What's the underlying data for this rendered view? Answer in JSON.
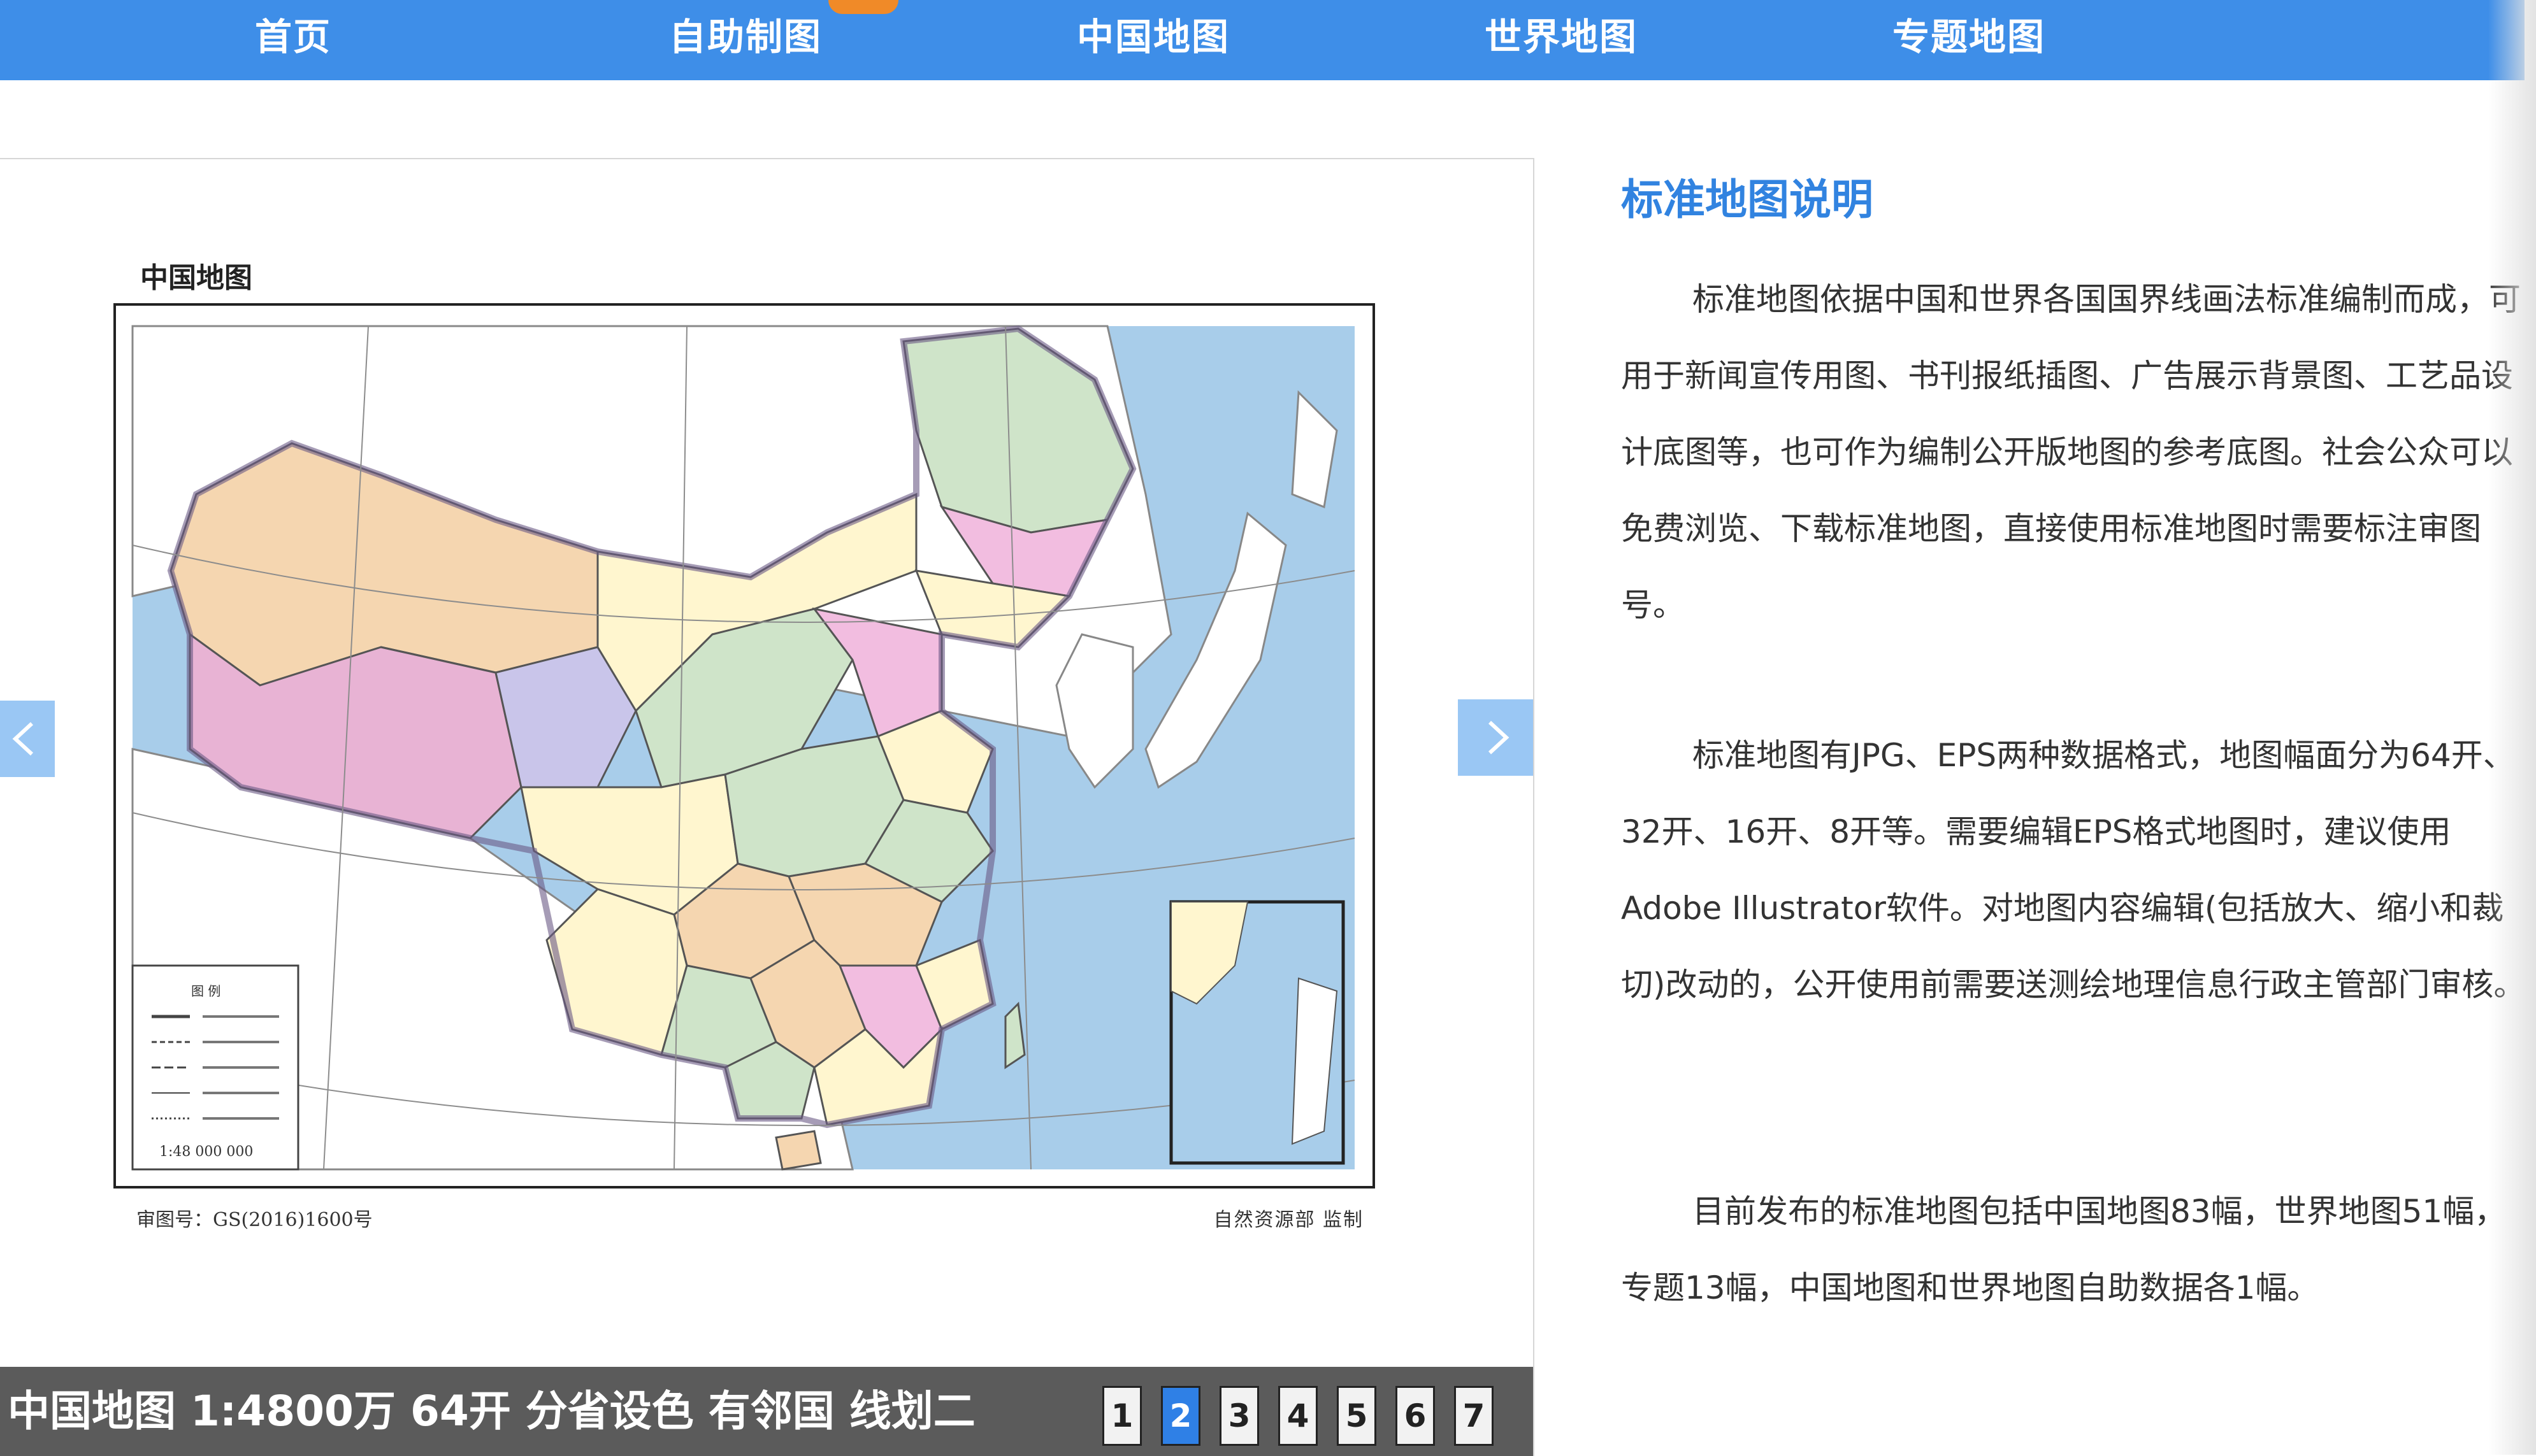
{
  "nav": {
    "items": [
      {
        "label": "首页"
      },
      {
        "label": "自助制图"
      },
      {
        "label": "中国地图"
      },
      {
        "label": "世界地图"
      },
      {
        "label": "专题地图"
      }
    ]
  },
  "slider": {
    "map_title": "中国地图",
    "legend_title": "图 例",
    "legend_scale": "1:48 000 000",
    "approval_number": "审图号：GS(2016)1600号",
    "publisher": "自然资源部  监制",
    "caption": "中国地图 1:4800万 64开 分省设色 有邻国 线划二",
    "pages": [
      "1",
      "2",
      "3",
      "4",
      "5",
      "6",
      "7"
    ],
    "active_page": "2",
    "prev_icon": "chevron-left-icon",
    "next_icon": "chevron-right-icon"
  },
  "info": {
    "title": "标准地图说明",
    "paragraphs": [
      "标准地图依据中国和世界各国国界线画法标准编制而成，可用于新闻宣传用图、书刊报纸插图、广告展示背景图、工艺品设计底图等，也可作为编制公开版地图的参考底图。社会公众可以免费浏览、下载标准地图，直接使用标准地图时需要标注审图号。",
      "标准地图有JPG、EPS两种数据格式，地图幅面分为64开、32开、16开、8开等。需要编辑EPS格式地图时，建议使用Adobe Illustrator软件。对地图内容编辑(包括放大、缩小和裁切)改动的，公开使用前需要送测绘地理信息行政主管部门审核。",
      "目前发布的标准地图包括中国地图83幅，世界地图51幅，专题13幅，中国地图和世界地图自助数据各1幅。"
    ]
  },
  "colors": {
    "nav_bg": "#3e8ee8",
    "accent": "#3183e0",
    "active_page": "#2f80e6",
    "caption_bar": "#5b5b5b",
    "sea": "#a8cdea"
  }
}
